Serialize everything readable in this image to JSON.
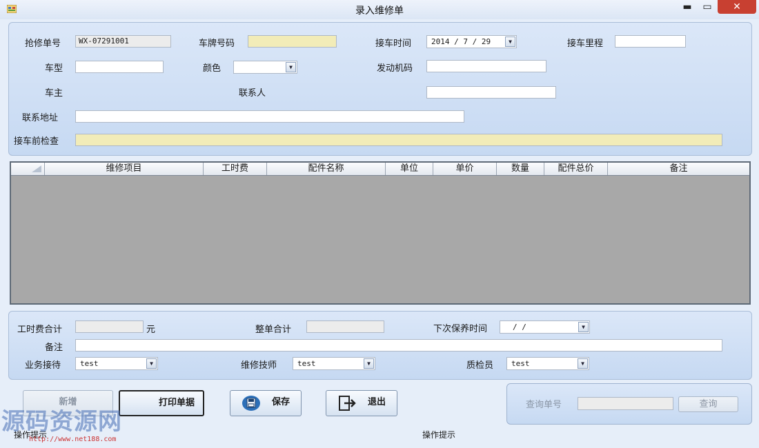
{
  "window": {
    "title": "录入维修单",
    "minimize": "▬",
    "maximize": "▭",
    "close": "✕"
  },
  "header_form": {
    "order_no_label": "抢修单号",
    "order_no_value": "WX-07291001",
    "plate_label": "车牌号码",
    "plate_value": "",
    "pickup_time_label": "接车时间",
    "pickup_time_value": "2014 / 7 / 29",
    "mileage_label": "接车里程",
    "mileage_value": "",
    "model_label": "车型",
    "model_value": "",
    "color_label": "颜色",
    "color_value": "",
    "engine_label": "发动机码",
    "engine_value": "",
    "owner_label": "车主",
    "contact_label": "联系人",
    "contact_value": "",
    "address_label": "联系地址",
    "address_value": "",
    "precheck_label": "接车前检查",
    "precheck_value": ""
  },
  "grid": {
    "columns": [
      "维修项目",
      "工时费",
      "配件名称",
      "单位",
      "单价",
      "数量",
      "配件总价",
      "备注"
    ],
    "rows": []
  },
  "footer_form": {
    "labor_total_label": "工时费合计",
    "labor_total_value": "",
    "labor_unit": "元",
    "order_total_label": "整单合计",
    "order_total_value": "",
    "next_service_label": "下次保养时间",
    "next_service_value": "/   /",
    "remark_label": "备注",
    "remark_value": "",
    "reception_label": "业务接待",
    "reception_value": "test",
    "technician_label": "维修技师",
    "technician_value": "test",
    "inspector_label": "质检员",
    "inspector_value": "test"
  },
  "actions": {
    "new": "新增",
    "print": "打印单据",
    "save": "保存",
    "exit": "退出"
  },
  "query": {
    "label": "查询单号",
    "value": "",
    "button": "查询"
  },
  "status": {
    "left": "操作提示",
    "center": "操作提示"
  },
  "watermark": {
    "text": "源码资源网",
    "url": "http://www.net188.com"
  },
  "colors": {
    "accent": "#c6d9f2",
    "highlight_field": "#f2ecb8",
    "grid_bg": "#a8a8a8",
    "close": "#c84031"
  }
}
